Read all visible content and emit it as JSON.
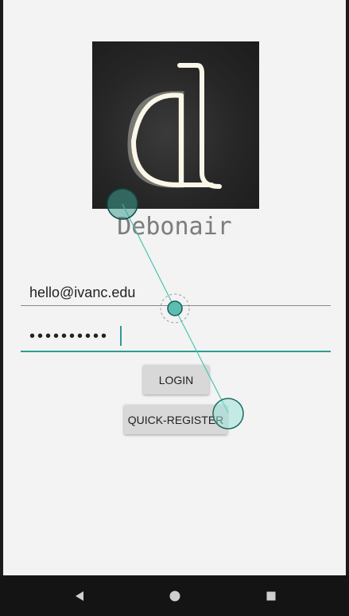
{
  "app": {
    "title": "Debonair"
  },
  "login_form": {
    "email_value": "hello@ivanc.edu",
    "password_value": "••••••••••",
    "login_label": "LOGIN",
    "register_label": "QUICK-REGISTER"
  },
  "colors": {
    "accent": "#2e9c91",
    "background": "#f3f3f3",
    "navbar": "#141414",
    "button": "#d8d8d8",
    "title": "#7c7c7c"
  },
  "nav": {
    "back_icon": "back-triangle-icon",
    "home_icon": "home-circle-icon",
    "recents_icon": "recents-square-icon"
  }
}
